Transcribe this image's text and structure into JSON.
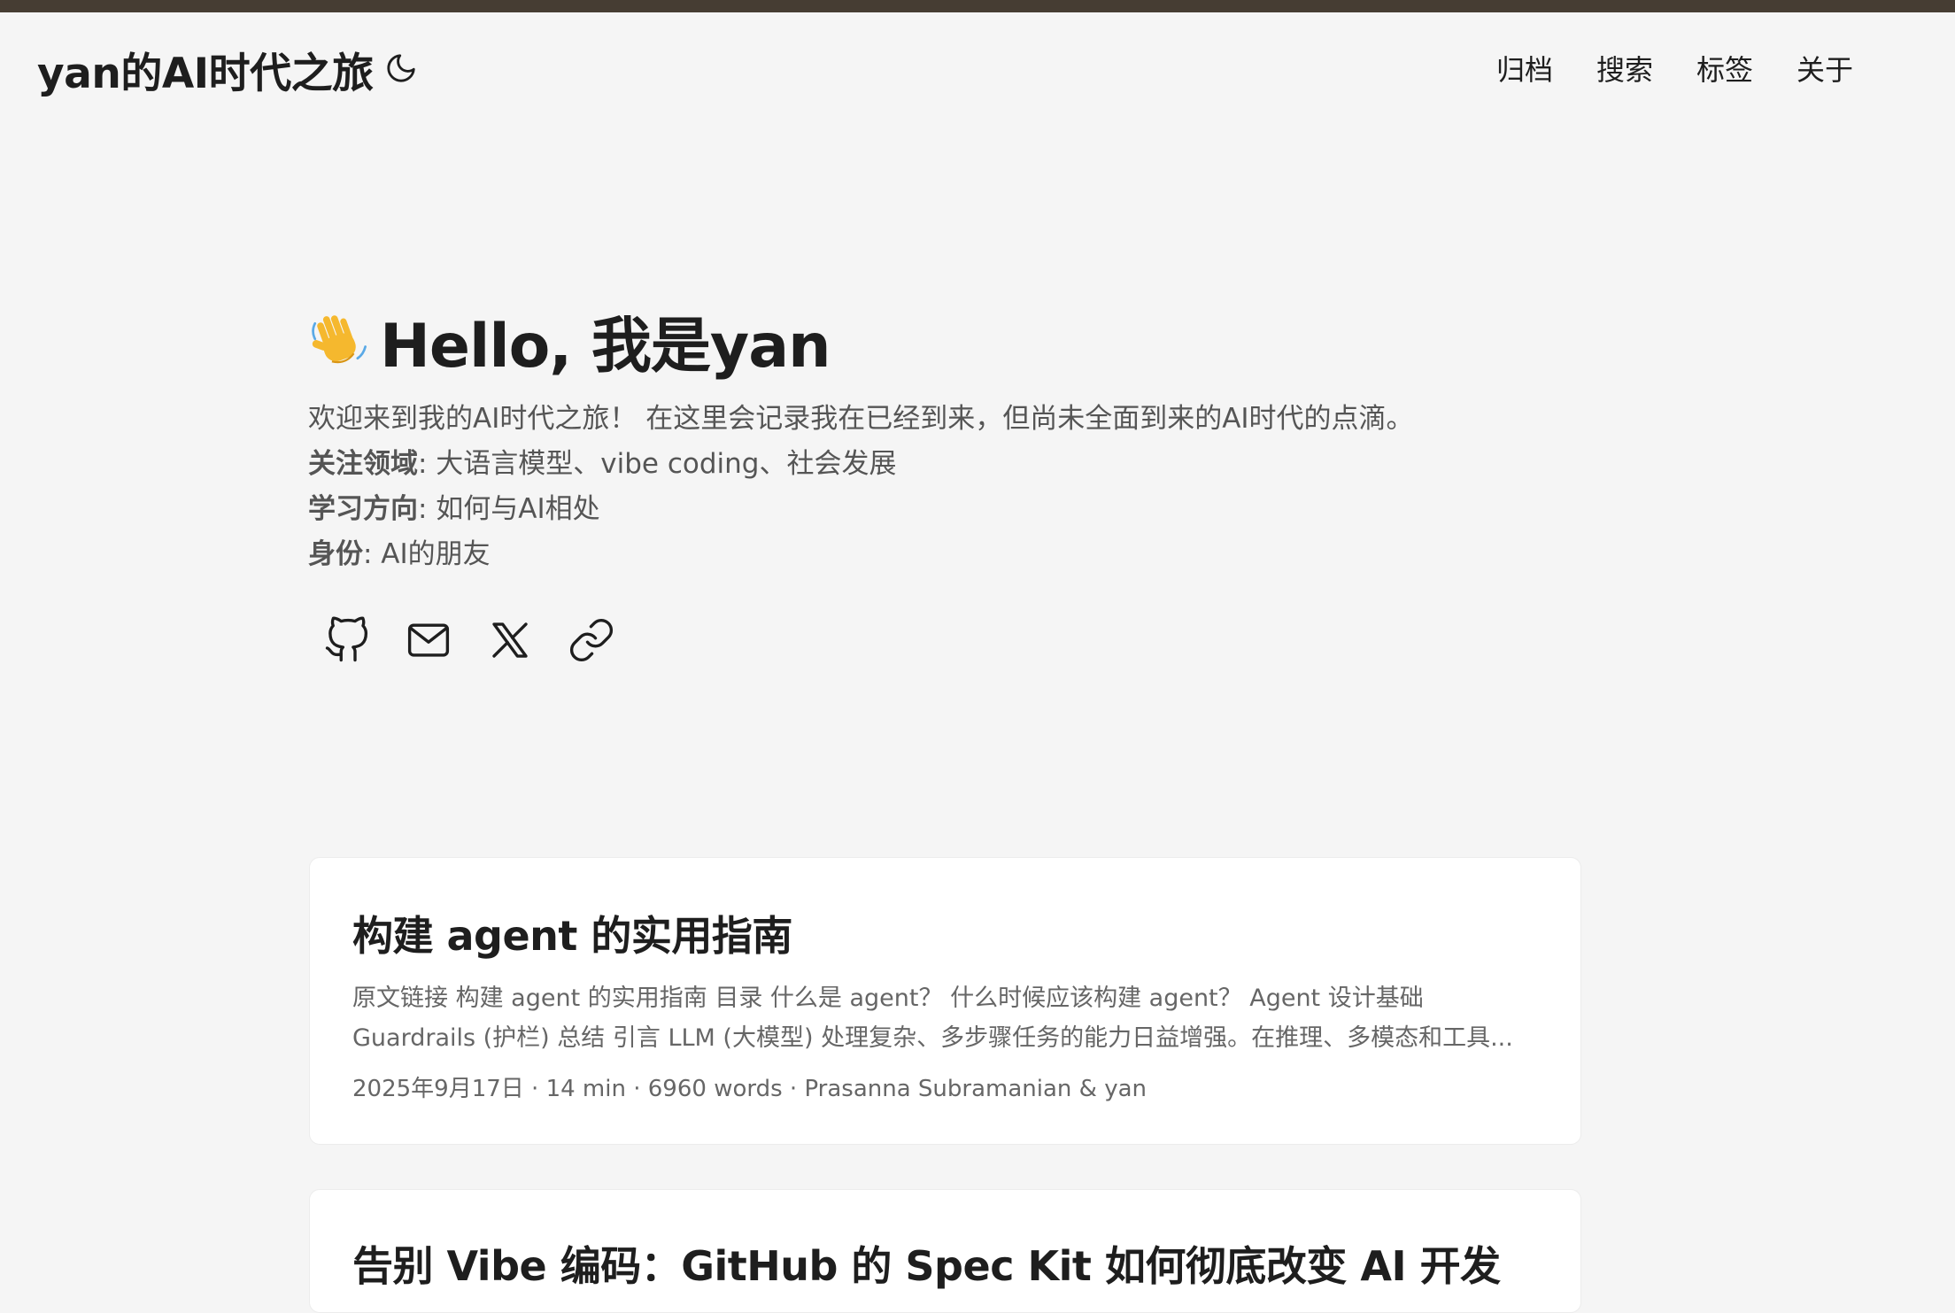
{
  "header": {
    "site_title": "yan的AI时代之旅",
    "theme_toggle_icon": "moon-icon",
    "nav": [
      "归档",
      "搜索",
      "标签",
      "关于"
    ]
  },
  "hero": {
    "emoji": "wave-icon",
    "title": "Hello, 我是yan",
    "intro": "欢迎来到我的AI时代之旅！ 在这里会记录我在已经到来，但尚未全面到来的AI时代的点滴。",
    "lines": [
      {
        "label": "关注领域",
        "value": ": 大语言模型、vibe coding、社会发展"
      },
      {
        "label": "学习方向",
        "value": ": 如何与AI相处"
      },
      {
        "label": "身份",
        "value": ": AI的朋友"
      }
    ],
    "social_icons": [
      "github-icon",
      "mail-icon",
      "x-icon",
      "link-icon"
    ]
  },
  "posts": [
    {
      "title": "构建 agent 的实用指南",
      "excerpt_line1": "原文链接 构建 agent 的实用指南 目录 什么是 agent？ 什么时候应该构建 agent？ Agent 设计基础",
      "excerpt_line2": "Guardrails (护栏) 总结 引言 LLM (大模型) 处理复杂、多步骤任务的能力日益增强。在推理、多模态和工具...",
      "meta": "2025年9月17日 · 14 min · 6960 words · Prasanna Subramanian & yan"
    },
    {
      "title": "告别 Vibe 编码：GitHub 的 Spec Kit 如何彻底改变 AI 开发"
    }
  ],
  "colors": {
    "topbar": "#463d33",
    "background": "#f5f5f5",
    "card": "#ffffff"
  }
}
